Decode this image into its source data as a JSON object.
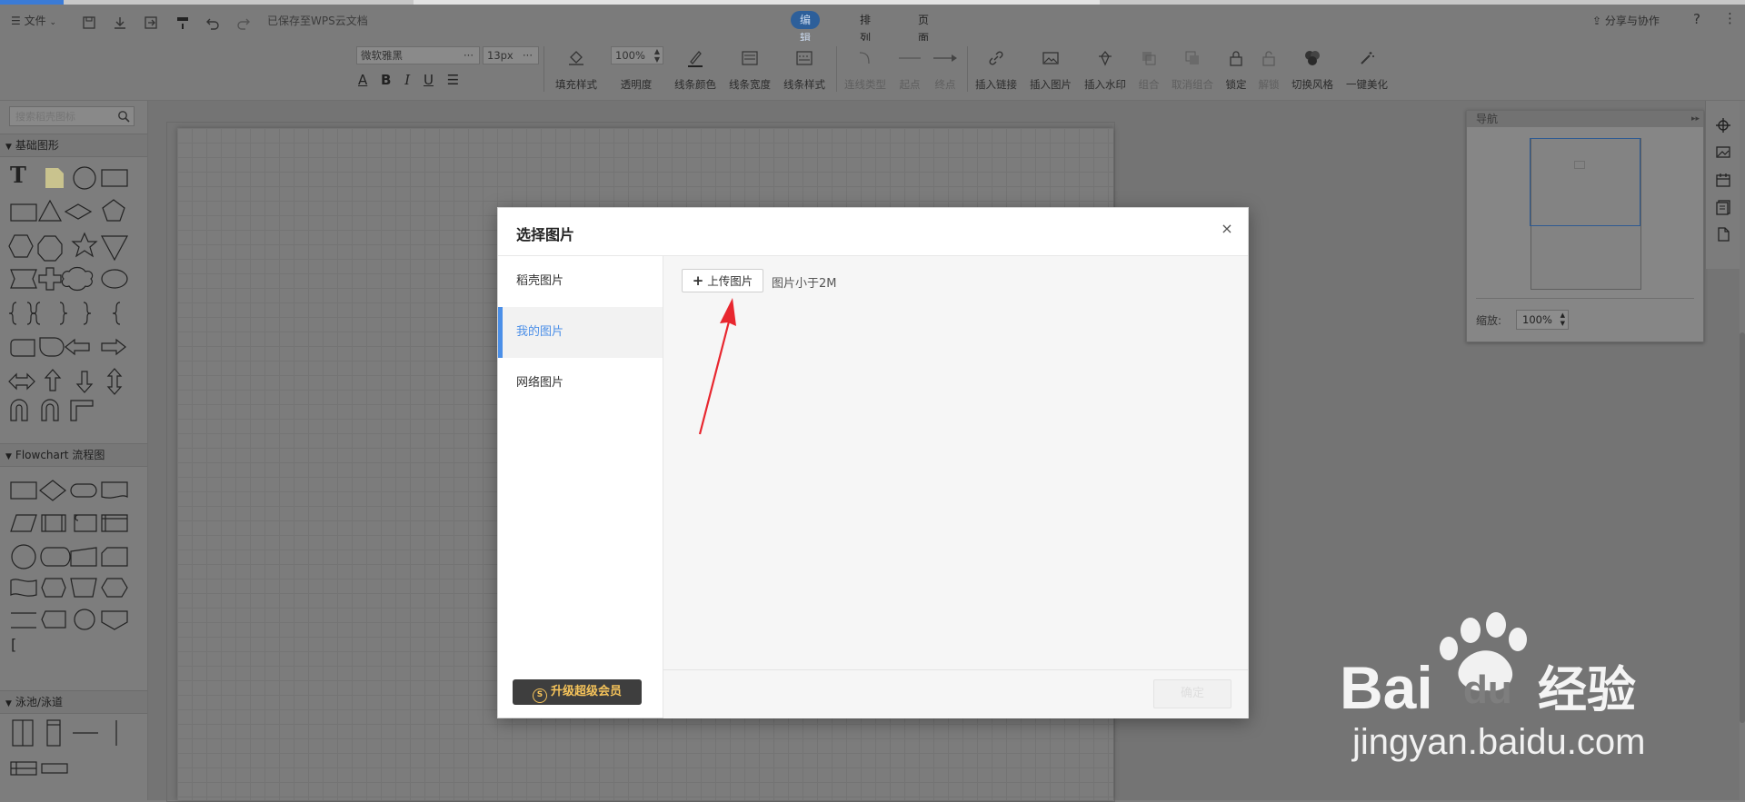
{
  "topbar": {
    "file_menu": "文件",
    "save_status": "已保存至WPS云文档",
    "mode_tabs": [
      "编辑",
      "排列",
      "页面"
    ],
    "share_label": "分享与协作",
    "help_label": "?"
  },
  "toolbar": {
    "font_family": "微软雅黑",
    "font_size": "13px",
    "opacity_value": "100%",
    "tools": [
      {
        "label": "填充样式"
      },
      {
        "label": "透明度"
      },
      {
        "label": "线条颜色"
      },
      {
        "label": "线条宽度"
      },
      {
        "label": "线条样式"
      },
      {
        "label": "连线类型"
      },
      {
        "label": "起点"
      },
      {
        "label": "终点"
      },
      {
        "label": "插入链接"
      },
      {
        "label": "插入图片"
      },
      {
        "label": "插入水印"
      },
      {
        "label": "组合"
      },
      {
        "label": "取消组合"
      },
      {
        "label": "锁定"
      },
      {
        "label": "解锁"
      },
      {
        "label": "切换风格"
      },
      {
        "label": "一键美化"
      }
    ]
  },
  "left_panel": {
    "search_placeholder": "搜索稻壳图标",
    "sections": [
      "基础图形",
      "Flowchart 流程图",
      "泳池/泳道"
    ]
  },
  "navigator": {
    "title": "导航",
    "zoom_label": "缩放:",
    "zoom_value": "100%"
  },
  "modal": {
    "title": "选择图片",
    "close": "×",
    "side_items": [
      "稻壳图片",
      "我的图片",
      "网络图片"
    ],
    "active_item": "我的图片",
    "vip_button": "升级超级会员",
    "vip_coin": "S",
    "upload_button": "上传图片",
    "upload_hint": "图片小于2M",
    "confirm_button": "确定"
  },
  "watermark": {
    "brand": "Bai",
    "brand_du": "du",
    "brand_cn": "经验",
    "url": "jingyan.baidu.com"
  },
  "colors": {
    "accent": "#4b8fe8",
    "vip_gold": "#f5c35a",
    "arrow_red": "#e8272f"
  }
}
